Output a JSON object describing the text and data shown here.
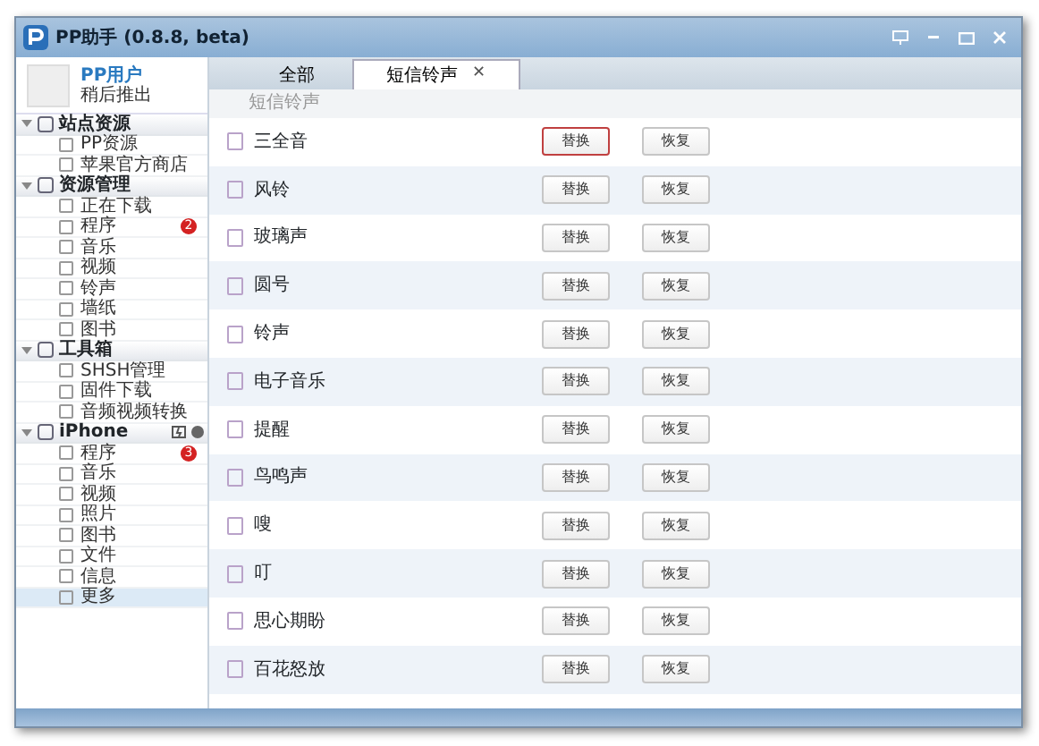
{
  "window": {
    "title": "PP助手 (0.8.8, beta)"
  },
  "user": {
    "name": "PP用户",
    "status": "稍后推出"
  },
  "sidebar": [
    {
      "label": "站点资源",
      "kind": "group",
      "expanded": true,
      "children": [
        {
          "label": "PP资源",
          "selected": false
        },
        {
          "label": "苹果官方商店",
          "selected": false
        }
      ]
    },
    {
      "label": "资源管理",
      "kind": "group",
      "expanded": true,
      "children": [
        {
          "label": "正在下载",
          "selected": false
        },
        {
          "label": "程序",
          "badge": "2",
          "selected": false
        },
        {
          "label": "音乐",
          "selected": false
        },
        {
          "label": "视频",
          "selected": false
        },
        {
          "label": "铃声",
          "selected": false
        },
        {
          "label": "墙纸",
          "selected": false
        },
        {
          "label": "图书",
          "selected": false
        }
      ]
    },
    {
      "label": "工具箱",
      "kind": "group",
      "expanded": true,
      "children": [
        {
          "label": "SHSH管理",
          "selected": false
        },
        {
          "label": "固件下载",
          "selected": false
        },
        {
          "label": "音频视频转换",
          "selected": false
        }
      ]
    },
    {
      "label": "iPhone",
      "kind": "device",
      "expanded": true,
      "children": [
        {
          "label": "程序",
          "badge": "3",
          "selected": false
        },
        {
          "label": "音乐",
          "selected": false
        },
        {
          "label": "视频",
          "selected": false
        },
        {
          "label": "照片",
          "selected": false
        },
        {
          "label": "图书",
          "selected": false
        },
        {
          "label": "文件",
          "selected": false
        },
        {
          "label": "信息",
          "selected": false
        },
        {
          "label": "更多",
          "selected": true
        }
      ]
    }
  ],
  "tabs": [
    {
      "label": "全部",
      "selected": false
    },
    {
      "label": "短信铃声",
      "selected": true,
      "close": "✕"
    }
  ],
  "section_title": "短信铃声",
  "ringtones": [
    {
      "name": "三全音",
      "replace": "替换",
      "restore": "恢复",
      "focused": true
    },
    {
      "name": "风铃",
      "replace": "替换",
      "restore": "恢复",
      "focused": false
    },
    {
      "name": "玻璃声",
      "replace": "替换",
      "restore": "恢复",
      "focused": false
    },
    {
      "name": "圆号",
      "replace": "替换",
      "restore": "恢复",
      "focused": false
    },
    {
      "name": "铃声",
      "replace": "替换",
      "restore": "恢复",
      "focused": false
    },
    {
      "name": "电子音乐",
      "replace": "替换",
      "restore": "恢复",
      "focused": false
    },
    {
      "name": "提醒",
      "replace": "替换",
      "restore": "恢复",
      "focused": false
    },
    {
      "name": "鸟鸣声",
      "replace": "替换",
      "restore": "恢复",
      "focused": false
    },
    {
      "name": "嗖",
      "replace": "替换",
      "restore": "恢复",
      "focused": false
    },
    {
      "name": "叮",
      "replace": "替换",
      "restore": "恢复",
      "focused": false
    },
    {
      "name": "思心期盼",
      "replace": "替换",
      "restore": "恢复",
      "focused": false
    },
    {
      "name": "百花怒放",
      "replace": "替换",
      "restore": "恢复",
      "focused": false
    }
  ]
}
